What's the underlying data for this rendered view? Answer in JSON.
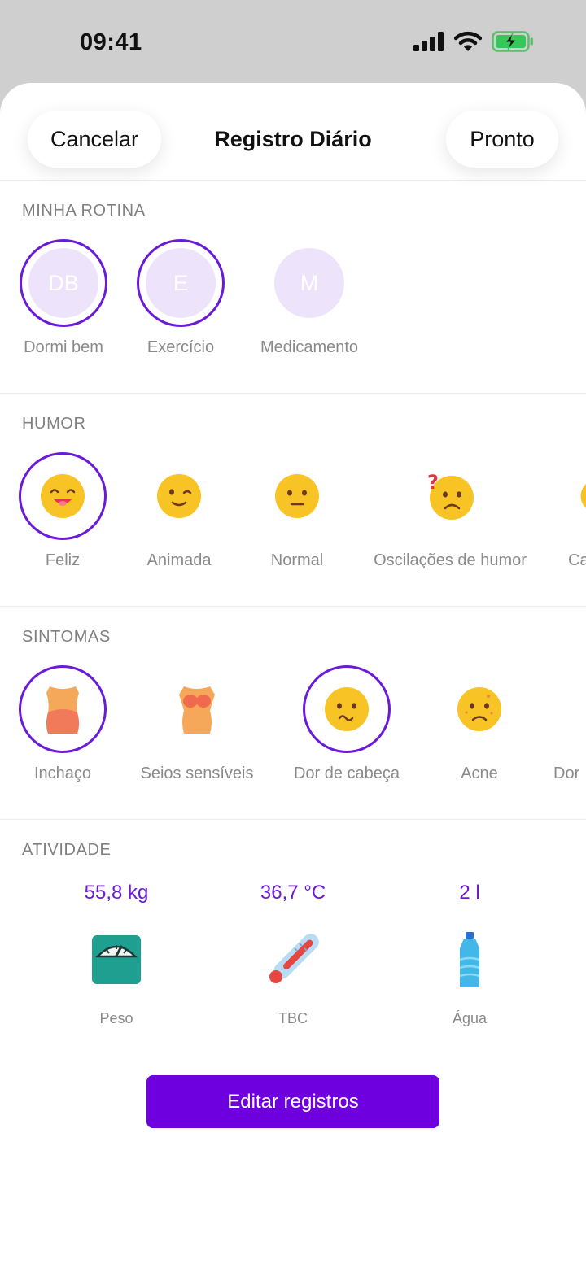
{
  "status": {
    "time": "09:41"
  },
  "header": {
    "cancel": "Cancelar",
    "title": "Registro Diário",
    "done": "Pronto"
  },
  "routine": {
    "title": "MINHA ROTINA",
    "items": [
      {
        "initials": "DB",
        "label": "Dormi bem",
        "selected": true
      },
      {
        "initials": "E",
        "label": "Exercício",
        "selected": true
      },
      {
        "initials": "M",
        "label": "Medicamento",
        "selected": false
      }
    ]
  },
  "mood": {
    "title": "HUMOR",
    "items": [
      {
        "icon": "happy-face-icon",
        "label": "Feliz",
        "selected": true
      },
      {
        "icon": "winking-face-icon",
        "label": "Animada",
        "selected": false
      },
      {
        "icon": "neutral-face-icon",
        "label": "Normal",
        "selected": false
      },
      {
        "icon": "confused-face-icon",
        "label": "Oscilações de humor",
        "selected": false
      },
      {
        "icon": "face-icon",
        "label": "Ca",
        "selected": false
      }
    ]
  },
  "symptoms": {
    "title": "SINTOMAS",
    "items": [
      {
        "icon": "bloating-torso-icon",
        "label": "Inchaço",
        "selected": true
      },
      {
        "icon": "sensitive-breasts-icon",
        "label": "Seios sensíveis",
        "selected": false
      },
      {
        "icon": "headache-face-icon",
        "label": "Dor de cabeça",
        "selected": true
      },
      {
        "icon": "acne-face-icon",
        "label": "Acne",
        "selected": false
      },
      {
        "icon": "pain-icon",
        "label": "Dor",
        "selected": false
      }
    ]
  },
  "activity": {
    "title": "ATIVIDADE",
    "items": [
      {
        "value": "55,8 kg",
        "label": "Peso",
        "icon": "scale-icon"
      },
      {
        "value": "36,7 °C",
        "label": "TBC",
        "icon": "thermometer-icon"
      },
      {
        "value": "2 l",
        "label": "Água",
        "icon": "water-bottle-icon"
      }
    ]
  },
  "edit_button": "Editar registros",
  "colors": {
    "accent": "#6e00e0",
    "ring": "#6a1ad8",
    "emoji": "#f7c325"
  }
}
